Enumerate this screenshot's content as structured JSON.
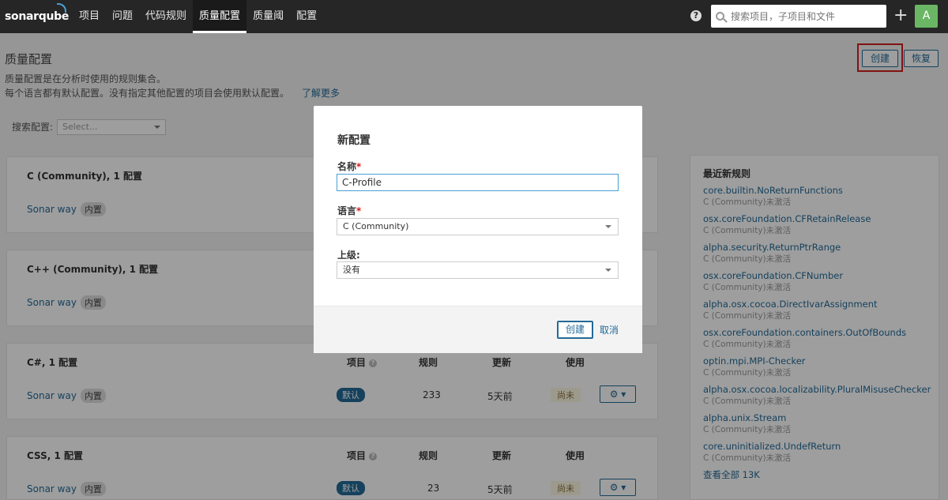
{
  "nav": {
    "logo": "sonarqube",
    "items": [
      "项目",
      "问题",
      "代码规则",
      "质量配置",
      "质量阈",
      "配置"
    ],
    "active_index": 3,
    "help": "?",
    "search_placeholder": "搜索项目，子项目和文件",
    "plus": "+",
    "avatar": "A"
  },
  "page": {
    "title": "质量配置",
    "desc1": "质量配置是在分析时使用的规则集合。",
    "desc2": "每个语言都有默认配置。没有指定其他配置的项目会使用默认配置。",
    "learn_more": "了解更多",
    "create_button": "创建",
    "restore_button": "恢复",
    "filter_label": "搜索配置:",
    "filter_placeholder": "Select..."
  },
  "columns": {
    "projects": "项目",
    "rules": "规则",
    "updated": "更新",
    "used": "使用"
  },
  "cards": [
    {
      "title": "C (Community), 1 配置",
      "profile": "Sonar way",
      "builtin": "内置"
    },
    {
      "title": "C++ (Community), 1 配置",
      "profile": "Sonar way",
      "builtin": "内置"
    },
    {
      "title": "C#, 1 配置",
      "profile": "Sonar way",
      "builtin": "内置",
      "default": "默认",
      "rules": "233",
      "updated": "5天前",
      "used": "尚未"
    },
    {
      "title": "CSS, 1 配置",
      "profile": "Sonar way",
      "builtin": "内置",
      "default": "默认",
      "rules": "23",
      "updated": "5天前",
      "used": "尚未"
    }
  ],
  "gear_icon": "⚙ ▾",
  "sidebar": {
    "title": "最近新规则",
    "rules": [
      {
        "name": "core.builtin.NoReturnFunctions",
        "meta": "C (Community)未激活"
      },
      {
        "name": "osx.coreFoundation.CFRetainRelease",
        "meta": "C (Community)未激活"
      },
      {
        "name": "alpha.security.ReturnPtrRange",
        "meta": "C (Community)未激活"
      },
      {
        "name": "osx.coreFoundation.CFNumber",
        "meta": "C (Community)未激活"
      },
      {
        "name": "alpha.osx.cocoa.DirectIvarAssignment",
        "meta": "C (Community)未激活"
      },
      {
        "name": "osx.coreFoundation.containers.OutOfBounds",
        "meta": "C (Community)未激活"
      },
      {
        "name": "optin.mpi.MPI-Checker",
        "meta": "C (Community)未激活"
      },
      {
        "name": "alpha.osx.cocoa.localizability.PluralMisuseChecker",
        "meta": "C (Community)未激活"
      },
      {
        "name": "alpha.unix.Stream",
        "meta": "C (Community)未激活"
      },
      {
        "name": "core.uninitialized.UndefReturn",
        "meta": "C (Community)未激活"
      }
    ],
    "see_all": "查看全部 13K"
  },
  "modal": {
    "title": "新配置",
    "name_label": "名称",
    "name_value": "C-Profile",
    "language_label": "语言",
    "language_value": "C (Community)",
    "parent_label": "上级:",
    "parent_value": "没有",
    "required_mark": "*",
    "create_button": "创建",
    "cancel_button": "取消"
  }
}
